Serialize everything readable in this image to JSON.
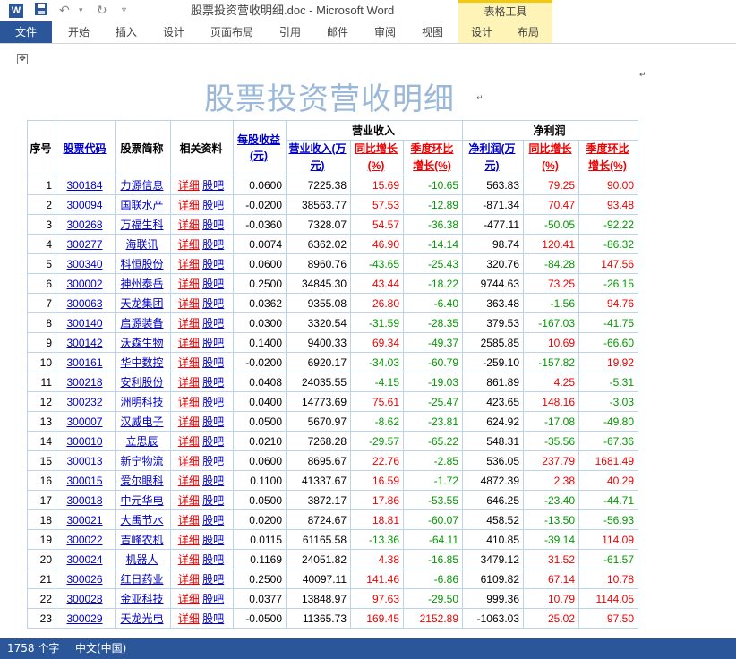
{
  "window": {
    "title": "股票投资营收明细.doc - Microsoft Word",
    "app_icon": "W",
    "context_group": "表格工具"
  },
  "ribbon": {
    "tabs": [
      "文件",
      "开始",
      "插入",
      "设计",
      "页面布局",
      "引用",
      "邮件",
      "审阅",
      "视图",
      "设计",
      "布局"
    ]
  },
  "document": {
    "heading": "股票投资营收明细",
    "table_handle": "✥",
    "headers": {
      "seq": "序号",
      "code": "股票代码",
      "name": "股票简称",
      "links": "相关资料",
      "eps": "每股收益(元)",
      "revenue_group": "营业收入",
      "profit_group": "净利润",
      "revenue": "营业收入(万元)",
      "rev_yoy": "同比增长(%)",
      "rev_qoq": "季度环比增长(%)",
      "profit": "净利润(万元)",
      "profit_yoy": "同比增长(%)",
      "profit_qoq": "季度环比增长(%)"
    },
    "detail_label": "详细",
    "forum_label": "股吧",
    "rows": [
      {
        "seq": "1",
        "code": "300184",
        "name": "力源信息",
        "eps": "0.0600",
        "rev": "7225.38",
        "rev_yoy": "15.69",
        "rev_qoq": "-10.65",
        "profit": "563.83",
        "p_yoy": "79.25",
        "p_qoq": "90.00"
      },
      {
        "seq": "2",
        "code": "300094",
        "name": "国联水产",
        "eps": "-0.0200",
        "rev": "38563.77",
        "rev_yoy": "57.53",
        "rev_qoq": "-12.89",
        "profit": "-871.34",
        "p_yoy": "70.47",
        "p_qoq": "93.48"
      },
      {
        "seq": "3",
        "code": "300268",
        "name": "万福生科",
        "eps": "-0.0360",
        "rev": "7328.07",
        "rev_yoy": "54.57",
        "rev_qoq": "-36.38",
        "profit": "-477.11",
        "p_yoy": "-50.05",
        "p_qoq": "-92.22"
      },
      {
        "seq": "4",
        "code": "300277",
        "name": "海联讯",
        "eps": "0.0074",
        "rev": "6362.02",
        "rev_yoy": "46.90",
        "rev_qoq": "-14.14",
        "profit": "98.74",
        "p_yoy": "120.41",
        "p_qoq": "-86.32"
      },
      {
        "seq": "5",
        "code": "300340",
        "name": "科恒股份",
        "eps": "0.0600",
        "rev": "8960.76",
        "rev_yoy": "-43.65",
        "rev_qoq": "-25.43",
        "profit": "320.76",
        "p_yoy": "-84.28",
        "p_qoq": "147.56"
      },
      {
        "seq": "6",
        "code": "300002",
        "name": "神州泰岳",
        "eps": "0.2500",
        "rev": "34845.30",
        "rev_yoy": "43.44",
        "rev_qoq": "-18.22",
        "profit": "9744.63",
        "p_yoy": "73.25",
        "p_qoq": "-26.15"
      },
      {
        "seq": "7",
        "code": "300063",
        "name": "天龙集团",
        "eps": "0.0362",
        "rev": "9355.08",
        "rev_yoy": "26.80",
        "rev_qoq": "-6.40",
        "profit": "363.48",
        "p_yoy": "-1.56",
        "p_qoq": "94.76"
      },
      {
        "seq": "8",
        "code": "300140",
        "name": "启源装备",
        "eps": "0.0300",
        "rev": "3320.54",
        "rev_yoy": "-31.59",
        "rev_qoq": "-28.35",
        "profit": "379.53",
        "p_yoy": "-167.03",
        "p_qoq": "-41.75"
      },
      {
        "seq": "9",
        "code": "300142",
        "name": "沃森生物",
        "eps": "0.1400",
        "rev": "9400.33",
        "rev_yoy": "69.34",
        "rev_qoq": "-49.37",
        "profit": "2585.85",
        "p_yoy": "10.69",
        "p_qoq": "-66.60"
      },
      {
        "seq": "10",
        "code": "300161",
        "name": "华中数控",
        "eps": "-0.0200",
        "rev": "6920.17",
        "rev_yoy": "-34.03",
        "rev_qoq": "-60.79",
        "profit": "-259.10",
        "p_yoy": "-157.82",
        "p_qoq": "19.92"
      },
      {
        "seq": "11",
        "code": "300218",
        "name": "安利股份",
        "eps": "0.0408",
        "rev": "24035.55",
        "rev_yoy": "-4.15",
        "rev_qoq": "-19.03",
        "profit": "861.89",
        "p_yoy": "4.25",
        "p_qoq": "-5.31"
      },
      {
        "seq": "12",
        "code": "300232",
        "name": "洲明科技",
        "eps": "0.0400",
        "rev": "14773.69",
        "rev_yoy": "75.61",
        "rev_qoq": "-25.47",
        "profit": "423.65",
        "p_yoy": "148.16",
        "p_qoq": "-3.03"
      },
      {
        "seq": "13",
        "code": "300007",
        "name": "汉威电子",
        "eps": "0.0500",
        "rev": "5670.97",
        "rev_yoy": "-8.62",
        "rev_qoq": "-23.81",
        "profit": "624.92",
        "p_yoy": "-17.08",
        "p_qoq": "-49.80"
      },
      {
        "seq": "14",
        "code": "300010",
        "name": "立思辰",
        "eps": "0.0210",
        "rev": "7268.28",
        "rev_yoy": "-29.57",
        "rev_qoq": "-65.22",
        "profit": "548.31",
        "p_yoy": "-35.56",
        "p_qoq": "-67.36"
      },
      {
        "seq": "15",
        "code": "300013",
        "name": "新宁物流",
        "eps": "0.0600",
        "rev": "8695.67",
        "rev_yoy": "22.76",
        "rev_qoq": "-2.85",
        "profit": "536.05",
        "p_yoy": "237.79",
        "p_qoq": "1681.49"
      },
      {
        "seq": "16",
        "code": "300015",
        "name": "爱尔眼科",
        "eps": "0.1100",
        "rev": "41337.67",
        "rev_yoy": "16.59",
        "rev_qoq": "-1.72",
        "profit": "4872.39",
        "p_yoy": "2.38",
        "p_qoq": "40.29"
      },
      {
        "seq": "17",
        "code": "300018",
        "name": "中元华电",
        "eps": "0.0500",
        "rev": "3872.17",
        "rev_yoy": "17.86",
        "rev_qoq": "-53.55",
        "profit": "646.25",
        "p_yoy": "-23.40",
        "p_qoq": "-44.71"
      },
      {
        "seq": "18",
        "code": "300021",
        "name": "大禹节水",
        "eps": "0.0200",
        "rev": "8724.67",
        "rev_yoy": "18.81",
        "rev_qoq": "-60.07",
        "profit": "458.52",
        "p_yoy": "-13.50",
        "p_qoq": "-56.93"
      },
      {
        "seq": "19",
        "code": "300022",
        "name": "吉峰农机",
        "eps": "0.0115",
        "rev": "61165.58",
        "rev_yoy": "-13.36",
        "rev_qoq": "-64.11",
        "profit": "410.85",
        "p_yoy": "-39.14",
        "p_qoq": "114.09"
      },
      {
        "seq": "20",
        "code": "300024",
        "name": "机器人",
        "eps": "0.1169",
        "rev": "24051.82",
        "rev_yoy": "4.38",
        "rev_qoq": "-16.85",
        "profit": "3479.12",
        "p_yoy": "31.52",
        "p_qoq": "-61.57"
      },
      {
        "seq": "21",
        "code": "300026",
        "name": "红日药业",
        "eps": "0.2500",
        "rev": "40097.11",
        "rev_yoy": "141.46",
        "rev_qoq": "-6.86",
        "profit": "6109.82",
        "p_yoy": "67.14",
        "p_qoq": "10.78"
      },
      {
        "seq": "22",
        "code": "300028",
        "name": "金亚科技",
        "eps": "0.0377",
        "rev": "13848.97",
        "rev_yoy": "97.63",
        "rev_qoq": "-29.50",
        "profit": "999.36",
        "p_yoy": "10.79",
        "p_qoq": "1144.05"
      },
      {
        "seq": "23",
        "code": "300029",
        "name": "天龙光电",
        "eps": "-0.0500",
        "rev": "11365.73",
        "rev_yoy": "169.45",
        "rev_qoq": "2152.89",
        "profit": "-1063.03",
        "p_yoy": "25.02",
        "p_qoq": "97.50"
      }
    ]
  },
  "status": {
    "word_count": "1758 个字",
    "language": "中文(中国)"
  }
}
